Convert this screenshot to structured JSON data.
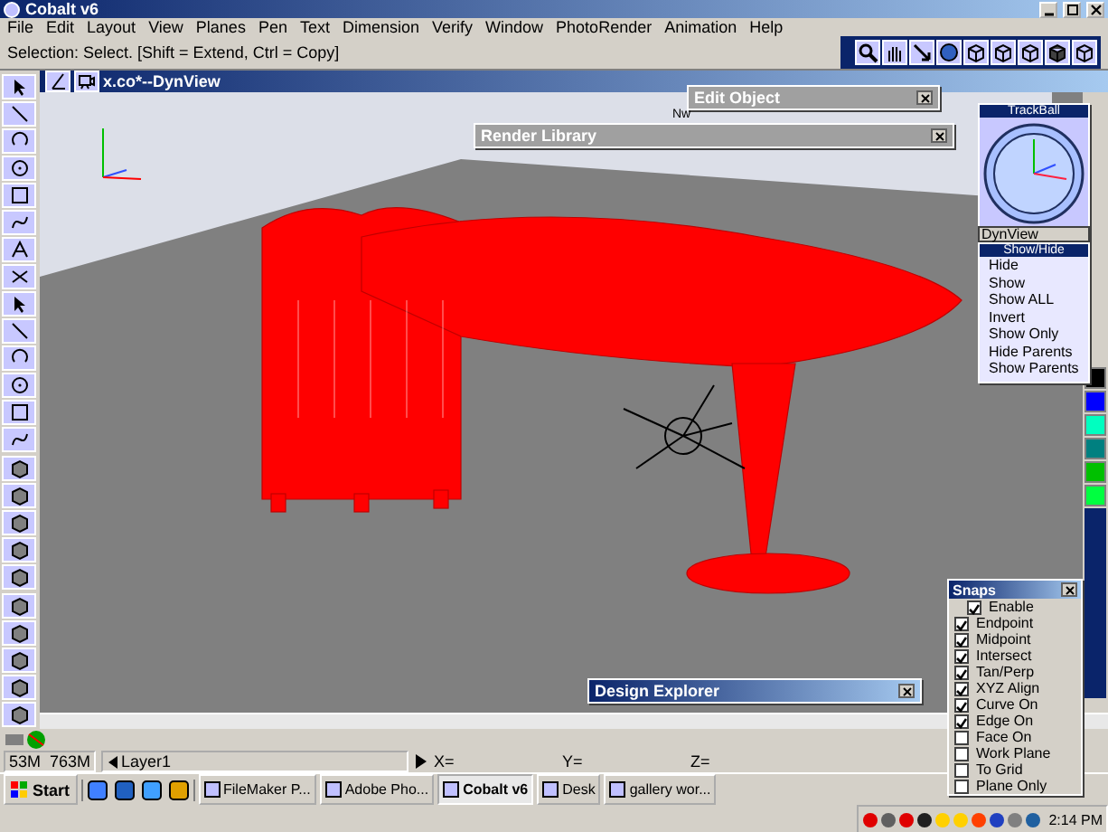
{
  "window": {
    "title": "Cobalt v6"
  },
  "menu": [
    "File",
    "Edit",
    "Layout",
    "View",
    "Planes",
    "Pen",
    "Text",
    "Dimension",
    "Verify",
    "Window",
    "PhotoRender",
    "Animation",
    "Help"
  ],
  "prompt": "Selection: Select. [Shift = Extend, Ctrl = Copy]",
  "viewport": {
    "title": "x.co*--DynView",
    "fragment": "Nw"
  },
  "panels": {
    "edit_object": "Edit Object",
    "render_library": "Render Library",
    "design_explorer": "Design Explorer"
  },
  "trackball": {
    "title": "TrackBall",
    "view": "DynView"
  },
  "show_hide": {
    "title": "Show/Hide",
    "items": [
      "Hide",
      "Show",
      "Show ALL",
      "Invert",
      "Show Only",
      "Hide Parents",
      "Show Parents"
    ]
  },
  "palette": [
    {
      "color": "#000000"
    },
    {
      "color": "#0000ff"
    },
    {
      "color": "#00ffc0"
    },
    {
      "color": "#008080"
    },
    {
      "color": "#00c000"
    },
    {
      "color": "#00ff40"
    }
  ],
  "snaps": {
    "title": "Snaps",
    "items": [
      {
        "label": "Enable",
        "checked": true,
        "kind": "master"
      },
      {
        "label": "Endpoint",
        "checked": true,
        "kind": "option"
      },
      {
        "label": "Midpoint",
        "checked": true,
        "kind": "option"
      },
      {
        "label": "Intersect",
        "checked": true,
        "kind": "option"
      },
      {
        "label": "Tan/Perp",
        "checked": true,
        "kind": "option"
      },
      {
        "label": "XYZ Align",
        "checked": true,
        "kind": "option"
      },
      {
        "label": "Curve On",
        "checked": true,
        "kind": "option"
      },
      {
        "label": "Edge On",
        "checked": true,
        "kind": "option"
      },
      {
        "label": "Face On",
        "checked": false,
        "kind": "option"
      },
      {
        "label": "Work Plane",
        "checked": false,
        "kind": "option"
      },
      {
        "label": "To Grid",
        "checked": false,
        "kind": "option"
      },
      {
        "label": "Plane Only",
        "checked": false,
        "kind": "option"
      }
    ]
  },
  "status_bar": {
    "memory": "53M  763M",
    "layer": "Layer1",
    "x": "X=",
    "y": "Y=",
    "z": "Z="
  },
  "taskbar": {
    "start": "Start",
    "tasks": [
      {
        "label": "FileMaker P...",
        "selected": false
      },
      {
        "label": "Adobe Pho...",
        "selected": false
      },
      {
        "label": "Cobalt v6",
        "selected": true
      },
      {
        "label": "Desk",
        "selected": false
      },
      {
        "label": "gallery wor...",
        "selected": false
      }
    ],
    "clock": "2:14 PM"
  }
}
